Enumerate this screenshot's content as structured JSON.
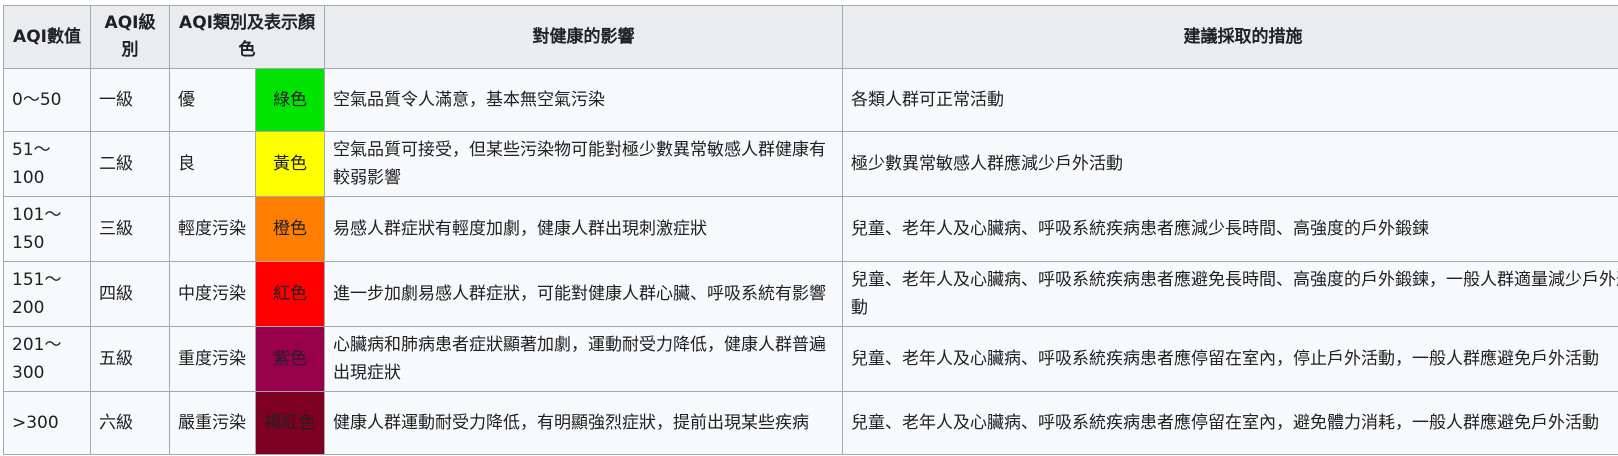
{
  "table": {
    "headers": {
      "aqi_value": "AQI數值",
      "aqi_level": "AQI級別",
      "category_color": "AQI類別及表示顏色",
      "health_effects": "對健康的影響",
      "suggested_measures": "建議採取的措施"
    },
    "rows": [
      {
        "value": "0～50",
        "level": "一級",
        "category": "優",
        "color_name": "綠色",
        "color_hex": "#00e400",
        "text_color": "#202122",
        "health": "空氣品質令人滿意，基本無空氣污染",
        "measures": "各類人群可正常活動"
      },
      {
        "value": "51～100",
        "level": "二級",
        "category": "良",
        "color_name": "黃色",
        "color_hex": "#ffff00",
        "text_color": "#202122",
        "health": "空氣品質可接受，但某些污染物可能對極少數異常敏感人群健康有較弱影響",
        "measures": "極少數異常敏感人群應減少戶外活動"
      },
      {
        "value": "101～150",
        "level": "三級",
        "category": "輕度污染",
        "color_name": "橙色",
        "color_hex": "#ff7e00",
        "text_color": "#202122",
        "health": "易感人群症狀有輕度加劇，健康人群出現刺激症狀",
        "measures": "兒童、老年人及心臟病、呼吸系統疾病患者應減少長時間、高強度的戶外鍛鍊"
      },
      {
        "value": "151～200",
        "level": "四級",
        "category": "中度污染",
        "color_name": "紅色",
        "color_hex": "#ff0000",
        "text_color": "#202122",
        "health": "進一步加劇易感人群症狀，可能對健康人群心臟、呼吸系統有影響",
        "measures": "兒童、老年人及心臟病、呼吸系統疾病患者應避免長時間、高強度的戶外鍛鍊，一般人群適量減少戶外運動"
      },
      {
        "value": "201～300",
        "level": "五級",
        "category": "重度污染",
        "color_name": "紫色",
        "color_hex": "#99004c",
        "text_color": "#202122",
        "health": "心臟病和肺病患者症狀顯著加劇，運動耐受力降低，健康人群普遍出現症狀",
        "measures": "兒童、老年人及心臟病、呼吸系統疾病患者應停留在室內，停止戶外活動，一般人群應避免戶外活動"
      },
      {
        "value": ">300",
        "level": "六級",
        "category": "嚴重污染",
        "color_name": "褐紅色",
        "color_hex": "#7e0023",
        "text_color": "#202122",
        "health": "健康人群運動耐受力降低，有明顯強烈症狀，提前出現某些疾病",
        "measures": "兒童、老年人及心臟病、呼吸系統疾病患者應停留在室內，避免體力消耗，一般人群應避免戶外活動"
      }
    ]
  }
}
